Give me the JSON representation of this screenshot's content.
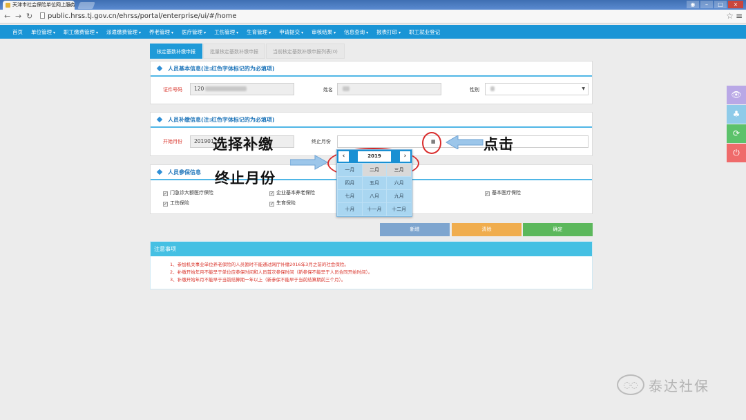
{
  "browser": {
    "tab_title": "天津市社会保险单位网上服务",
    "url": "public.hrss.tj.gov.cn/ehrss/portal/enterprise/ui/#/home"
  },
  "nav": {
    "items": [
      "首页",
      "单位管理",
      "职工缴费管理",
      "派遣缴费管理",
      "养老管理",
      "医疗管理",
      "工伤管理",
      "生育管理",
      "申请提交",
      "审核结果",
      "信息查询",
      "报表打印",
      "职工就业登记"
    ],
    "dropdown_items": [
      false,
      true,
      true,
      true,
      true,
      true,
      true,
      true,
      true,
      true,
      true,
      true,
      false
    ]
  },
  "page_tabs": [
    {
      "label": "核定基数补缴申报",
      "active": true
    },
    {
      "label": "批量核定基数补缴申报",
      "active": false
    },
    {
      "label": "当前核定基数补缴申报列表(0)",
      "active": false
    }
  ],
  "section1": {
    "title": "人员基本信息(注:红色字体标记的为必填项)",
    "id_label": "证件号码",
    "id_value": "120",
    "name_label": "姓名",
    "name_value": "",
    "gender_label": "性别",
    "gender_value": "",
    "gender_icon": "dropdown-caret-icon"
  },
  "section2": {
    "title": "人员补缴信息(注:红色字体标记的为必填项)",
    "start_label": "开始月份",
    "start_value": "201901",
    "end_label": "终止月份",
    "end_value": "",
    "calendar_icon": "calendar-icon"
  },
  "section3": {
    "title": "人员参保信息",
    "insurances": [
      {
        "label": "门急诊大额医疗保险",
        "checked": true
      },
      {
        "label": "企业基本养老保险",
        "checked": true
      },
      {
        "label": "基本医疗保险",
        "checked": true
      },
      {
        "label": "工伤保险",
        "checked": true
      },
      {
        "label": "生育保险",
        "checked": true
      }
    ]
  },
  "calendar": {
    "year": "2019",
    "prev": "‹",
    "next": "›",
    "months": [
      "一月",
      "二月",
      "三月",
      "四月",
      "五月",
      "六月",
      "七月",
      "八月",
      "九月",
      "十月",
      "十一月",
      "十二月"
    ],
    "highlighted": [
      "二月",
      "三月"
    ]
  },
  "annotations": {
    "select_line1": "选择补缴",
    "select_line2": "终止月份",
    "click": "点击"
  },
  "buttons": {
    "new": "新增",
    "clear": "清除",
    "confirm": "确定"
  },
  "button_colors": {
    "new": "#7ea5cf",
    "clear": "#f0ad4e",
    "confirm": "#5cb85c"
  },
  "notice": {
    "title": "注意事项",
    "lines": [
      "1、参加机关事业单位养老保险的人员暂时不能通过网厅补缴2016年3月之前的社会保险。",
      "2、补缴开始年月不能早于单位应参保时间和人员首次参保时间（新参保不能早于人员合同开始时间）。",
      "3、补缴开始年月不能早于当前结算期一年以上（新参保不能早于当前结算期前三个月）。"
    ]
  },
  "side_toolbar": [
    {
      "icon": "eye-icon",
      "glyph": "👁",
      "color": "#b9a8e6"
    },
    {
      "icon": "tree-icon",
      "glyph": "♣",
      "color": "#8fcbe9"
    },
    {
      "icon": "refresh-icon",
      "glyph": "⟳",
      "color": "#5cc26b"
    },
    {
      "icon": "power-icon",
      "glyph": "⏻",
      "color": "#ef6b6b"
    }
  ],
  "watermark": "泰达社保"
}
